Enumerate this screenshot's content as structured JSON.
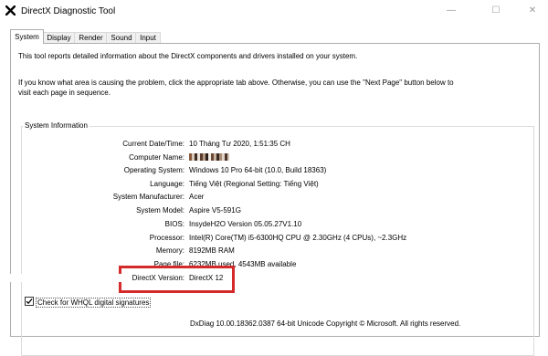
{
  "window": {
    "title": "DirectX Diagnostic Tool",
    "minimize_glyph": "—",
    "maximize_glyph": "☐",
    "close_glyph": "✕"
  },
  "tabs": [
    {
      "label": "System",
      "active": true
    },
    {
      "label": "Display",
      "active": false
    },
    {
      "label": "Render",
      "active": false
    },
    {
      "label": "Sound",
      "active": false
    },
    {
      "label": "Input",
      "active": false
    }
  ],
  "intro": {
    "line1": "This tool reports detailed information about the DirectX components and drivers installed on your system.",
    "line2": "If you know what area is causing the problem, click the appropriate tab above.  Otherwise, you can use the \"Next Page\" button below to",
    "line3": "visit each page in sequence."
  },
  "system_info": {
    "group_title": "System Information",
    "rows": [
      {
        "label": "Current Date/Time:",
        "value": "10 Tháng Tư 2020, 1:51:35 CH"
      },
      {
        "label": "Computer Name:",
        "value": ""
      },
      {
        "label": "Operating System:",
        "value": "Windows 10 Pro 64-bit (10.0, Build 18363)"
      },
      {
        "label": "Language:",
        "value": "Tiếng Việt (Regional Setting: Tiếng Việt)"
      },
      {
        "label": "System Manufacturer:",
        "value": "Acer"
      },
      {
        "label": "System Model:",
        "value": "Aspire V5-591G"
      },
      {
        "label": "BIOS:",
        "value": "InsydeH2O Version 05.05.27V1.10"
      },
      {
        "label": "Processor:",
        "value": "Intel(R) Core(TM) i5-6300HQ CPU @ 2.30GHz (4 CPUs), ~2.3GHz"
      },
      {
        "label": "Memory:",
        "value": "8192MB RAM"
      },
      {
        "label": "Page file:",
        "value": "6232MB used, 4543MB available"
      },
      {
        "label": "DirectX Version:",
        "value": "DirectX 12"
      }
    ]
  },
  "whql": {
    "label": "Check for WHQL digital signatures",
    "checked": true
  },
  "footer_text": "DxDiag 10.00.18362.0387 64-bit Unicode  Copyright © Microsoft. All rights reserved.",
  "colors": {
    "highlight_box": "#d42a2a",
    "tab_border": "#adadad"
  },
  "icons": {
    "app": "directx-x-icon",
    "checkbox": "checkmark-icon"
  }
}
